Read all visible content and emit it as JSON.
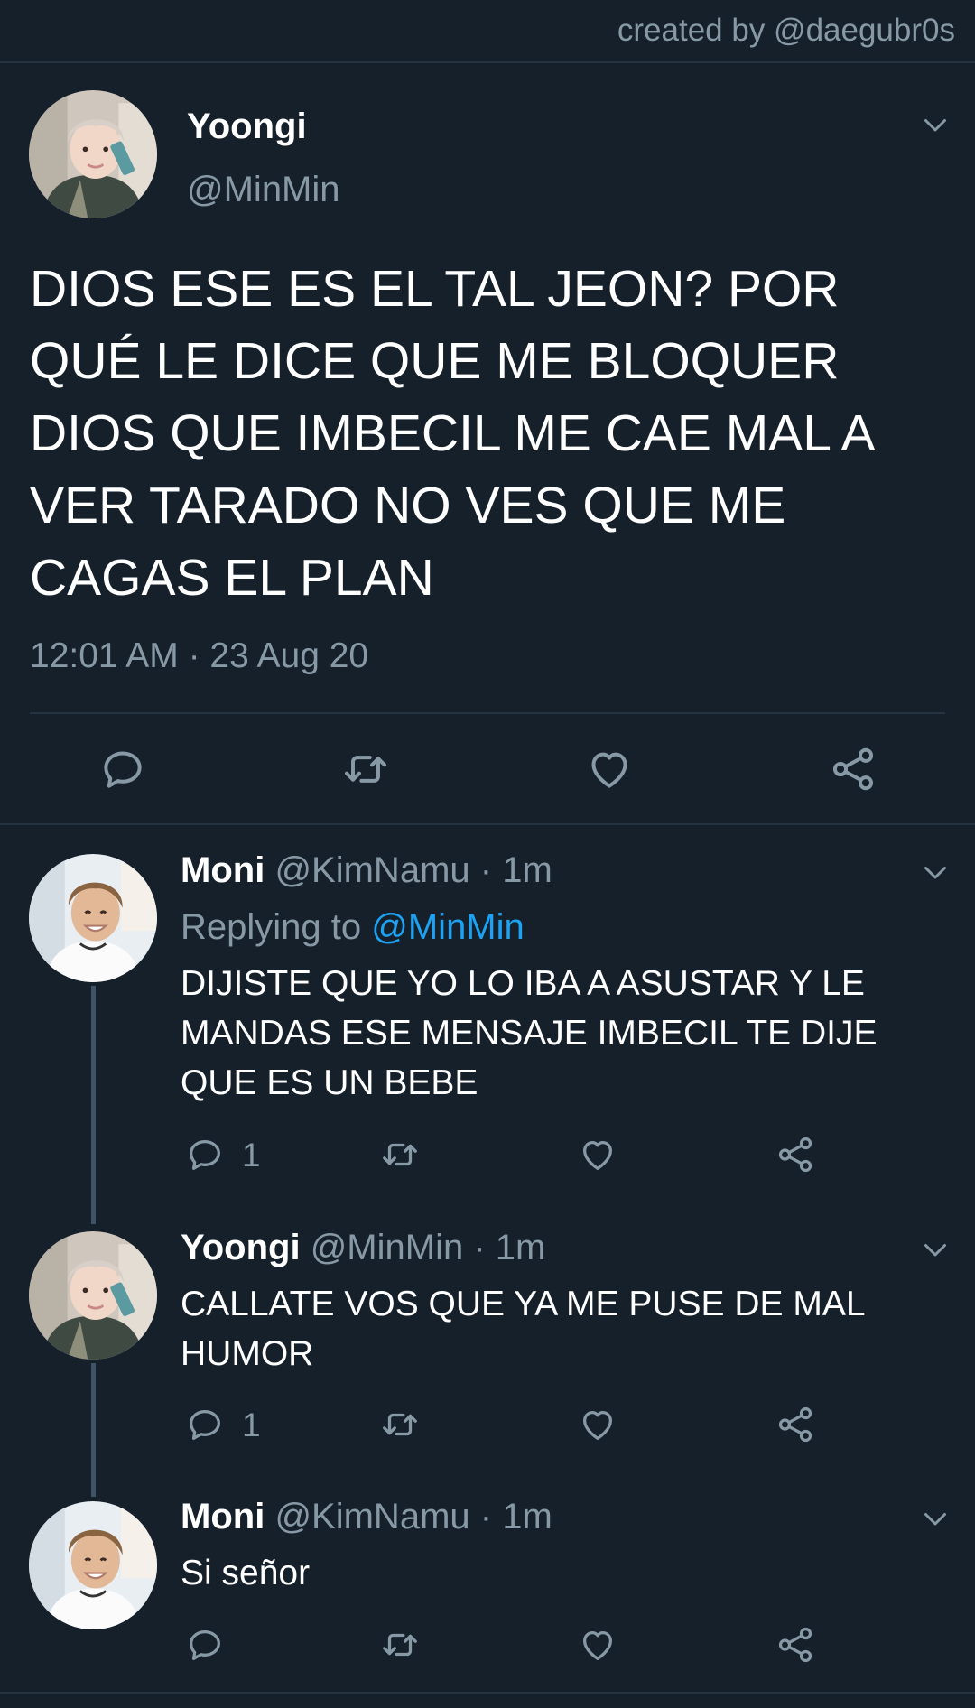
{
  "header": {
    "watermark": "created by @daegubr0s"
  },
  "main_tweet": {
    "name": "Yoongi",
    "handle": "@MinMin",
    "text": "DIOS ESE ES EL TAL JEON? POR QUÉ LE DICE QUE ME BLOQUER DIOS QUE IMBECIL ME CAE MAL A VER TARADO NO VES QUE ME CAGAS EL PLAN",
    "timestamp": "12:01 AM · 23 Aug 20",
    "actions": [
      "reply-icon",
      "retweet-icon",
      "like-icon",
      "share-icon"
    ]
  },
  "replies": [
    {
      "name": "Moni",
      "handle": "@KimNamu",
      "time": "· 1m",
      "replying_label": "Replying to",
      "replying_to": "@MinMin",
      "text": "DIJISTE QUE YO LO IBA A ASUSTAR Y LE MANDAS ESE MENSAJE IMBECIL TE DIJE QUE ES UN BEBE",
      "reply_count": "1"
    },
    {
      "name": "Yoongi",
      "handle": "@MinMin",
      "time": "· 1m",
      "text": "CALLATE VOS QUE YA ME PUSE DE MAL HUMOR",
      "reply_count": "1"
    },
    {
      "name": "Moni",
      "handle": "@KimNamu",
      "time": "· 1m",
      "text": "Si señor"
    }
  ],
  "colors": {
    "background": "#15202b",
    "muted": "#8899a6",
    "accent": "#1da1f2",
    "divider": "#253341"
  }
}
